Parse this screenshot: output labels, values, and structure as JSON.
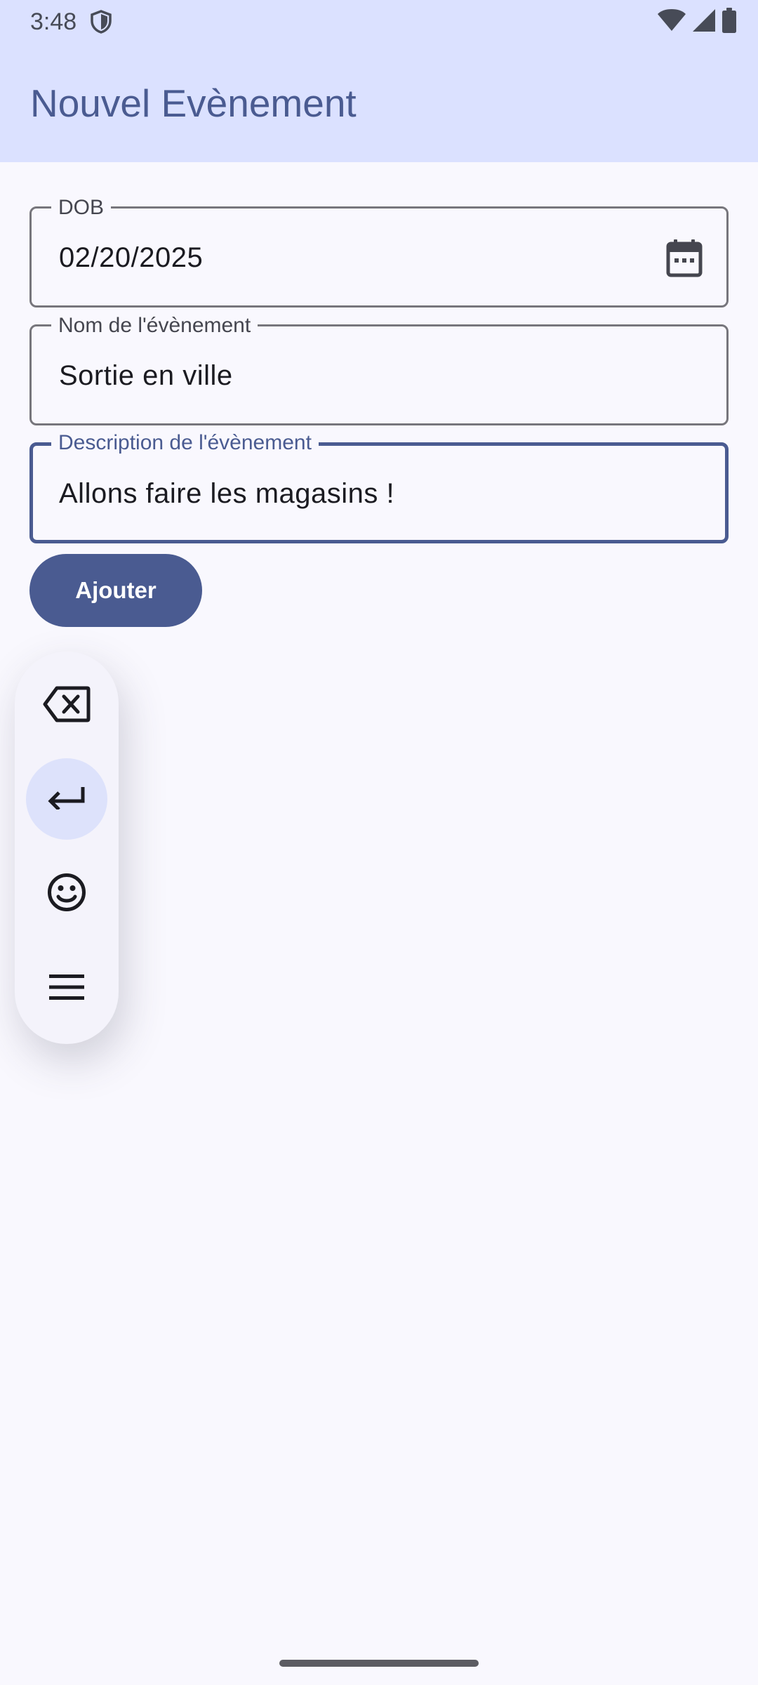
{
  "status_bar": {
    "time": "3:48",
    "icons": [
      "shield-icon",
      "wifi-icon",
      "cell-signal-icon",
      "battery-icon"
    ]
  },
  "app_bar": {
    "title": "Nouvel Evènement"
  },
  "form": {
    "dob": {
      "label": "DOB",
      "value": "02/20/2025",
      "icon": "calendar-icon"
    },
    "event_name": {
      "label": "Nom de l'évènement",
      "value": "Sortie en ville"
    },
    "event_description": {
      "label": "Description de l'évènement",
      "value": "Allons faire les magasins !",
      "focused": true
    },
    "submit_label": "Ajouter"
  },
  "floating_toolbar": {
    "items": [
      {
        "icon": "backspace-icon",
        "active": false
      },
      {
        "icon": "enter-icon",
        "active": true
      },
      {
        "icon": "emoji-icon",
        "active": false
      },
      {
        "icon": "menu-icon",
        "active": false
      }
    ]
  },
  "colors": {
    "app_bar_bg": "#dbe1ff",
    "primary": "#4a5b91",
    "background": "#f9f8fe",
    "outline": "#77767c"
  }
}
